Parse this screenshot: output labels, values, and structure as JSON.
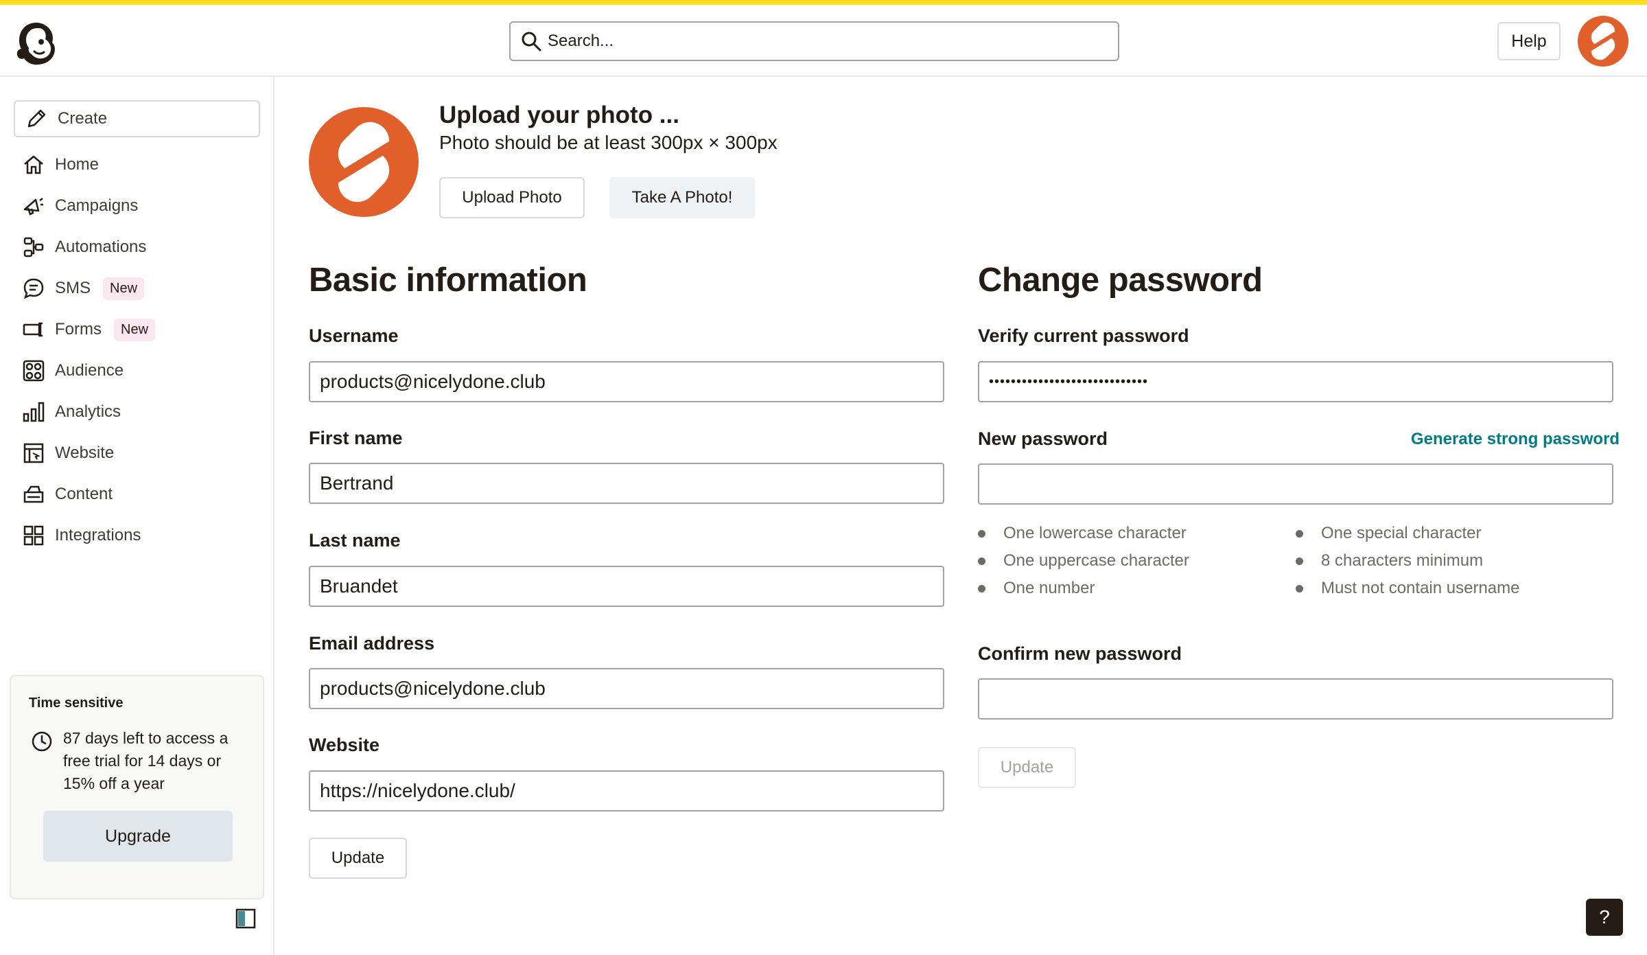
{
  "header": {
    "search_placeholder": "Search...",
    "help_label": "Help"
  },
  "sidebar": {
    "create_label": "Create",
    "items": [
      {
        "label": "Home",
        "icon": "home-icon"
      },
      {
        "label": "Campaigns",
        "icon": "megaphone-icon"
      },
      {
        "label": "Automations",
        "icon": "automations-icon"
      },
      {
        "label": "SMS",
        "icon": "sms-icon",
        "badge": "New"
      },
      {
        "label": "Forms",
        "icon": "forms-icon",
        "badge": "New"
      },
      {
        "label": "Audience",
        "icon": "audience-icon"
      },
      {
        "label": "Analytics",
        "icon": "analytics-icon"
      },
      {
        "label": "Website",
        "icon": "website-icon"
      },
      {
        "label": "Content",
        "icon": "content-icon"
      },
      {
        "label": "Integrations",
        "icon": "integrations-icon"
      }
    ],
    "trial": {
      "label": "Time sensitive",
      "text": "87 days left to access a free trial for 14 days or 15% off a year",
      "upgrade_label": "Upgrade"
    }
  },
  "photo": {
    "title": "Upload your photo ...",
    "subtitle": "Photo should be at least 300px × 300px",
    "upload_label": "Upload Photo",
    "take_label": "Take A Photo!"
  },
  "basic": {
    "title": "Basic information",
    "username_label": "Username",
    "username_value": "products@nicelydone.club",
    "first_name_label": "First name",
    "first_name_value": "Bertrand",
    "last_name_label": "Last name",
    "last_name_value": "Bruandet",
    "email_label": "Email address",
    "email_value": "products@nicelydone.club",
    "website_label": "Website",
    "website_value": "https://nicelydone.club/",
    "update_label": "Update"
  },
  "password": {
    "title": "Change password",
    "verify_label": "Verify current password",
    "verify_value": "•••••••••••••••••••••••••••••",
    "new_label": "New password",
    "generate_label": "Generate strong password",
    "requirements_left": [
      "One lowercase character",
      "One uppercase character",
      "One number"
    ],
    "requirements_right": [
      "One special character",
      "8 characters minimum",
      "Must not contain username"
    ],
    "confirm_label": "Confirm new password",
    "update_label": "Update"
  },
  "help_fab_label": "?",
  "colors": {
    "brand_yellow": "#ffe01b",
    "avatar_orange": "#e05f2b",
    "link_teal": "#007c89"
  }
}
